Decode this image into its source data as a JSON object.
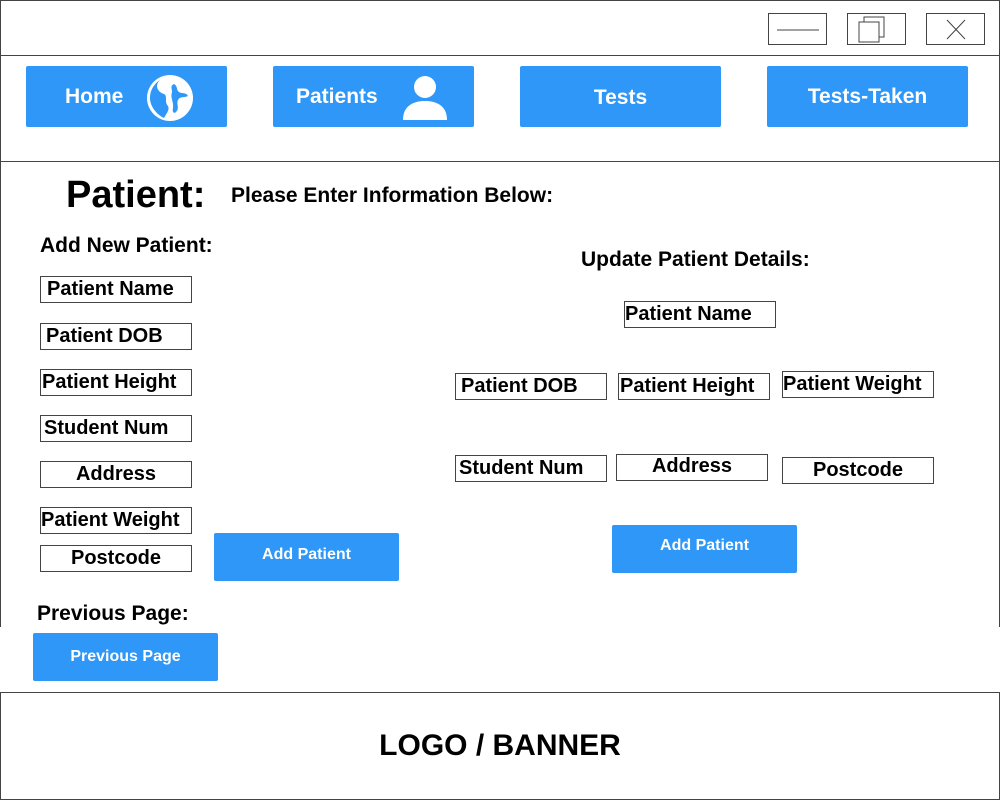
{
  "nav": {
    "home": "Home",
    "patients": "Patients",
    "tests": "Tests",
    "tests_taken": "Tests-Taken"
  },
  "page": {
    "title": "Patient:",
    "instruction": "Please Enter Information Below:"
  },
  "add_section": {
    "heading": "Add New Patient:",
    "fields": {
      "name": "Patient Name",
      "dob": "Patient DOB",
      "height": "Patient Height",
      "student_num": "Student Num",
      "address": "Address",
      "weight": "Patient Weight",
      "postcode": "Postcode"
    },
    "button": "Add Patient"
  },
  "update_section": {
    "heading": "Update Patient Details:",
    "fields": {
      "name": "Patient Name",
      "dob": "Patient DOB",
      "height": "Patient Height",
      "weight": "Patient Weight",
      "student_num": "Student Num",
      "address": "Address",
      "postcode": "Postcode"
    },
    "button": "Add Patient"
  },
  "previous": {
    "heading": "Previous Page:",
    "button": "Previous Page"
  },
  "footer": {
    "banner": "LOGO / BANNER"
  },
  "colors": {
    "accent": "#2e97f7",
    "border": "#444444"
  }
}
